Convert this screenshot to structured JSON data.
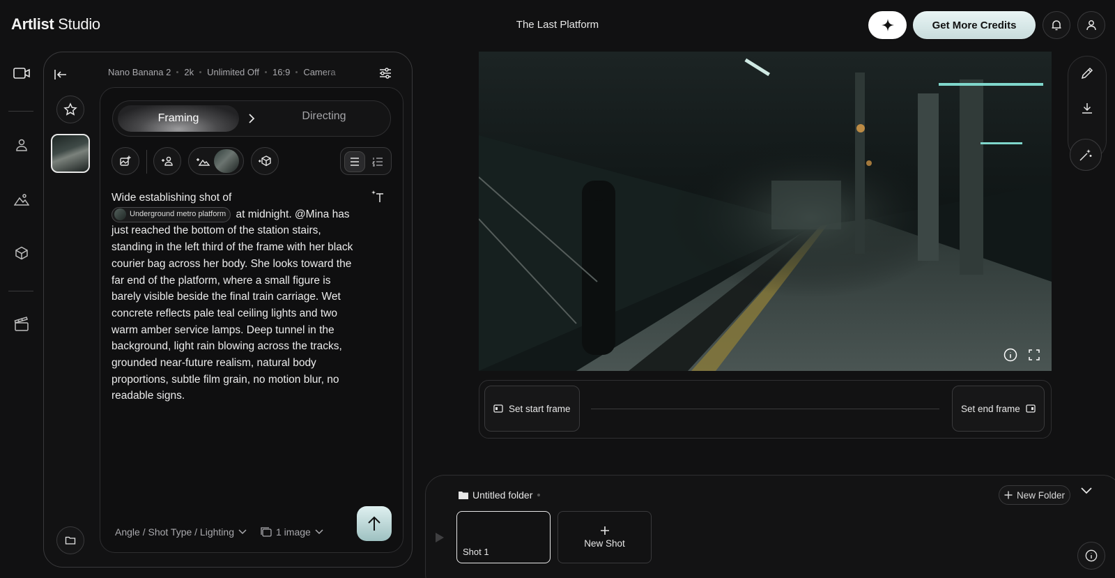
{
  "app": {
    "brand_bold": "Artlist",
    "brand_light": " Studio",
    "project_title": "The Last Platform"
  },
  "header": {
    "credits_label": "Get More Credits"
  },
  "settings": {
    "model": "Nano Banana 2",
    "resolution": "2k",
    "unlimited": "Unlimited Off",
    "aspect": "16:9",
    "camera": "Camera"
  },
  "tabs": {
    "framing": "Framing",
    "directing": "Directing"
  },
  "prompt": {
    "line1": "Wide establishing shot of",
    "location_chip": "Underground metro platform",
    "body": "at midnight. @Mina has just reached the bottom of the station stairs, standing in the left third of the frame with her black courier bag across her body. She looks toward the far end of the platform, where a small figure is barely visible beside the final train carriage. Wet concrete reflects pale teal ceiling lights and two warm amber service lamps. Deep tunnel in the background, light rain blowing across the tracks, grounded near-future realism, natural body proportions, subtle film grain, no motion blur, no readable signs."
  },
  "options": {
    "angle": "Angle / Shot Type / Lighting",
    "images": "1 image"
  },
  "frames": {
    "start": "Set start frame",
    "end": "Set end frame"
  },
  "folder": {
    "name": "Untitled folder",
    "new_folder": "New Folder",
    "shots": [
      "Shot 1"
    ],
    "new_shot": "New Shot"
  },
  "colors": {
    "accent": "#c8dcdc",
    "background": "#111112",
    "panel_border": "#3a3a3c"
  },
  "icons": {
    "rail": [
      "video-icon",
      "person-icon",
      "landscape-icon",
      "cube-icon",
      "clapperboard-icon"
    ],
    "right": [
      "pencil-icon",
      "download-icon",
      "magic-wand-icon"
    ]
  }
}
